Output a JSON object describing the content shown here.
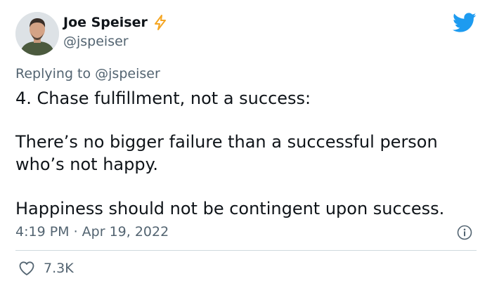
{
  "author": {
    "name": "Joe Speiser",
    "handle": "@jspeiser"
  },
  "reply": {
    "prefix": "Replying to ",
    "mention": "@jspeiser"
  },
  "tweet": {
    "paragraphs": [
      "4. Chase fulfillment, not a success:",
      "There’s no bigger failure than a successful person who’s not happy.",
      "Happiness should not be contingent upon success."
    ],
    "timestamp": "4:19 PM · Apr 19, 2022"
  },
  "engagement": {
    "likes": "7.3K"
  },
  "colors": {
    "brand": "#1d9bf0",
    "verified_bolt": "#f5a623",
    "text": "#0f1419",
    "secondary": "#536471",
    "divider": "#cfd9de"
  },
  "icons": [
    "bolt-icon",
    "twitter-bird-icon",
    "info-icon",
    "heart-icon"
  ]
}
